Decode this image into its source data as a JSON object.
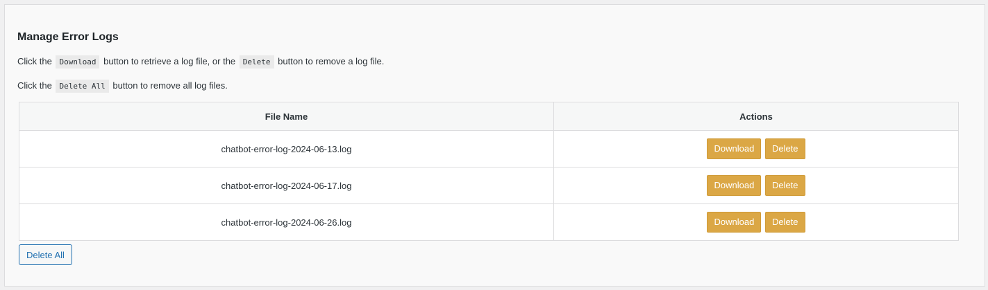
{
  "section": {
    "title": "Manage Error Logs",
    "instruction1": {
      "prefix": "Click the",
      "code1": "Download",
      "middle": "button to retrieve a log file, or the",
      "code2": "Delete",
      "suffix": "button to remove a log file."
    },
    "instruction2": {
      "prefix": "Click the",
      "code": "Delete All",
      "suffix": "button to remove all log files."
    }
  },
  "table": {
    "headers": [
      "File Name",
      "Actions"
    ],
    "rows": [
      {
        "file": "chatbot-error-log-2024-06-13.log",
        "download_label": "Download",
        "delete_label": "Delete"
      },
      {
        "file": "chatbot-error-log-2024-06-17.log",
        "download_label": "Download",
        "delete_label": "Delete"
      },
      {
        "file": "chatbot-error-log-2024-06-26.log",
        "download_label": "Download",
        "delete_label": "Delete"
      }
    ]
  },
  "delete_all_label": "Delete All",
  "colors": {
    "action_button": "#dba745",
    "delete_all_border": "#2271b1"
  }
}
